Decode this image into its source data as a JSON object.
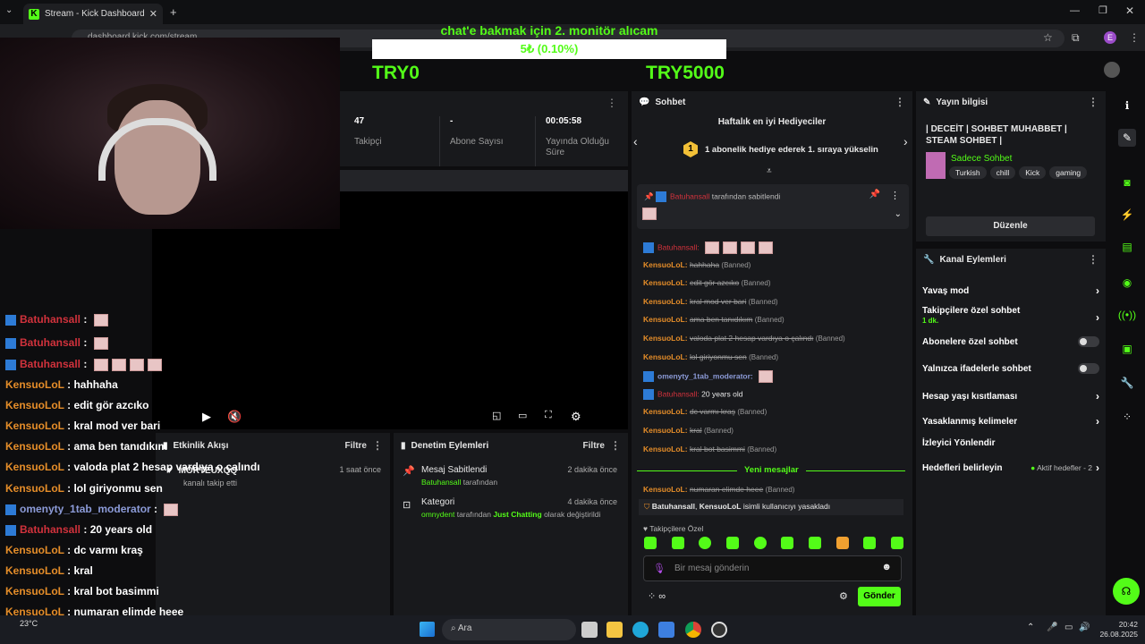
{
  "browser": {
    "tab_title": "Stream - Kick Dashboard",
    "url": "dashboard.kick.com/stream",
    "profile_initial": "E"
  },
  "overlay": {
    "title": "chat'e bakmak için 2. monitör alıcam",
    "progress_text": "5₺ (0.10%)",
    "progress_fraction": 0.001,
    "start_label": "TRY0",
    "end_label": "TRY5000"
  },
  "stats": {
    "followers_value": "47",
    "followers_label": "Takipçi",
    "subs_value": "-",
    "subs_label": "Abone Sayısı",
    "uptime_value": "00:05:58",
    "uptime_label_1": "Yayında Olduğu",
    "uptime_label_2": "Süre"
  },
  "chat_overlay": [
    {
      "user": "Batuhansall",
      "type": "b",
      "msg": "",
      "emotes": 1,
      "mod": true
    },
    {
      "user": "Batuhansall",
      "type": "b",
      "msg": "",
      "emotes": 1,
      "mod": true
    },
    {
      "user": "Batuhansall",
      "type": "b",
      "msg": "",
      "emotes": 4,
      "mod": true
    },
    {
      "user": "KensuoLoL",
      "type": "k",
      "msg": "hahhaha"
    },
    {
      "user": "KensuoLoL",
      "type": "k",
      "msg": "edit gör azcıko"
    },
    {
      "user": "KensuoLoL",
      "type": "k",
      "msg": "kral mod ver bari"
    },
    {
      "user": "KensuoLoL",
      "type": "k",
      "msg": "ama ben tanıdıkım"
    },
    {
      "user": "KensuoLoL",
      "type": "k",
      "msg": "valoda plat 2 hesap vardıya o çalındı"
    },
    {
      "user": "KensuoLoL",
      "type": "k",
      "msg": "lol giriyonmu sen"
    },
    {
      "user": "omenyty_1tab_moderator",
      "type": "m",
      "msg": "",
      "emotes": 1,
      "mod": true
    },
    {
      "user": "Batuhansall",
      "type": "b",
      "msg": "20 years old",
      "mod": true
    },
    {
      "user": "KensuoLoL",
      "type": "k",
      "msg": "dc varmı kraş"
    },
    {
      "user": "KensuoLoL",
      "type": "k",
      "msg": "kral"
    },
    {
      "user": "KensuoLoL",
      "type": "k",
      "msg": "kral bot basimmi"
    },
    {
      "user": "KensuoLoL",
      "type": "k",
      "msg": "numaran elimde heee"
    }
  ],
  "activity": {
    "title": "Etkinlik Akışı",
    "filter": "Filtre",
    "item_user": "MORTEUXQQ",
    "item_text": "kanalı takip etti",
    "item_time": "1 saat önce"
  },
  "moderation": {
    "title": "Denetim Eylemleri",
    "filter": "Filtre",
    "item1_title": "Mesaj Sabitlendi",
    "item1_user": "Batuhansall",
    "item1_suffix": "tarafından",
    "item1_time": "2 dakika önce",
    "item2_title": "Kategori",
    "item2_user": "omnydent",
    "item2_mid": "tarafından",
    "item2_cat": "Just Chatting",
    "item2_end": "olarak değiştirildi",
    "item2_time": "4 dakika önce"
  },
  "chat": {
    "title": "Sohbet",
    "gifters_title": "Haftalık en iyi Hediyeciler",
    "gifters_rank": "1",
    "gifters_text": "1 abonelik hediye ederek 1. sıraya yükselin",
    "pinned_user": "Batuhansall",
    "pinned_suffix": "tarafından sabitlendi",
    "new_messages": "Yeni mesajlar",
    "ban_user": "Batuhansall",
    "ban_target": "KensuoLoL",
    "ban_text": "isimli kullanıcıyı yasakladı",
    "followers_only": "Takipçilere Özel",
    "input_placeholder": "Bir mesaj gönderin",
    "send": "Gönder",
    "banned_tag": "(Banned)",
    "messages": [
      {
        "user": "Batuhansall",
        "type": "b",
        "msg": "",
        "emotes": 4
      },
      {
        "user": "KensuoLoL",
        "type": "k",
        "msg": "hahhaha",
        "banned": true
      },
      {
        "user": "KensuoLoL",
        "type": "k",
        "msg": "edit gör azcıko",
        "banned": true
      },
      {
        "user": "KensuoLoL",
        "type": "k",
        "msg": "kral mod ver bari",
        "banned": true
      },
      {
        "user": "KensuoLoL",
        "type": "k",
        "msg": "ama ben tanıdıkım",
        "banned": true
      },
      {
        "user": "KensuoLoL",
        "type": "k",
        "msg": "valoda plat 2 hesap vardıya o çalındı",
        "banned": true
      },
      {
        "user": "KensuoLoL",
        "type": "k",
        "msg": "lol giriyonmu sen",
        "banned": true
      },
      {
        "user": "omenyty_1tab_moderator",
        "type": "m",
        "msg": "",
        "emotes": 1
      },
      {
        "user": "Batuhansall",
        "type": "b",
        "msg": "20 years old"
      },
      {
        "user": "KensuoLoL",
        "type": "k",
        "msg": "dc varmı kraş",
        "banned": true
      },
      {
        "user": "KensuoLoL",
        "type": "k",
        "msg": "kral",
        "banned": true
      },
      {
        "user": "KensuoLoL",
        "type": "k",
        "msg": "kral bot basimmi",
        "banned": true
      }
    ],
    "after_new": {
      "user": "KensuoLoL",
      "msg": "numaran elimde heee"
    }
  },
  "stream_info": {
    "title": "Yayın bilgisi",
    "stream_title": "| DECEİT | SOHBET MUHABBET | STEAM SOHBET |",
    "category": "Sadece Sohbet",
    "tags": [
      "Turkish",
      "chill",
      "Kick",
      "gaming"
    ],
    "edit": "Düzenle"
  },
  "channel_actions": {
    "title": "Kanal Eylemleri",
    "slow_mode": "Yavaş mod",
    "followers_only": "Takipçilere özel sohbet",
    "followers_only_sub": "1 dk.",
    "subs_only": "Abonelere özel sohbet",
    "emotes_only": "Yalnızca ifadelerle sohbet",
    "account_age": "Hesap yaşı kısıtlaması",
    "banned_words": "Yasaklanmış kelimeler",
    "redirect": "İzleyici Yönlendir",
    "goals": "Hedefleri belirleyin",
    "goals_status": "Aktif hedefler - 2"
  },
  "taskbar": {
    "weather": "23°C",
    "search": "Ara",
    "time": "20:42",
    "date": "26.08.2025"
  },
  "colors": {
    "accent": "#53fc18",
    "panel": "#18191c",
    "kensuo": "#e58d29",
    "batuhan": "#d1323c",
    "moderator": "#8c9bd8"
  }
}
